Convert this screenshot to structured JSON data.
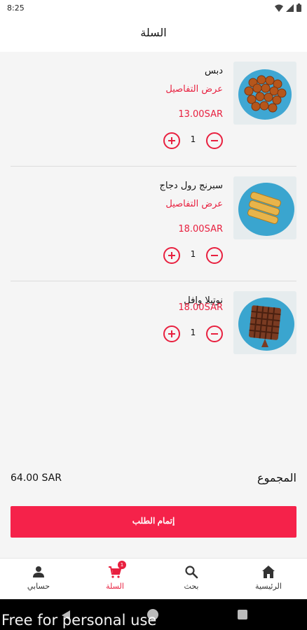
{
  "status_bar": {
    "time": "8:25"
  },
  "header": {
    "title": "السلة"
  },
  "cart": {
    "items": [
      {
        "name": "دبس",
        "details_link": "عرض التفاصيل",
        "price": "13.00SAR",
        "quantity": "1",
        "image": "dbs-balls-on-blue-plate"
      },
      {
        "name": "سبرنج رول دجاج",
        "details_link": "عرض التفاصيل",
        "price": "18.00SAR",
        "quantity": "1",
        "image": "spring-rolls-on-blue-plate"
      },
      {
        "name": "نوتيلا وافل",
        "details_link": "",
        "price": "18.00SAR",
        "quantity": "1",
        "image": "nutella-waffle-on-blue-plate"
      }
    ]
  },
  "summary": {
    "total_label": "المجموع",
    "total_value": "64.00 SAR"
  },
  "checkout": {
    "label": "إتمام الطلب"
  },
  "bottom_nav": {
    "items": [
      {
        "label": "حسابي",
        "icon": "person-icon"
      },
      {
        "label": "السلة",
        "icon": "cart-icon",
        "badge": "1",
        "active": true
      },
      {
        "label": "بحث",
        "icon": "search-icon"
      },
      {
        "label": "الرئيسية",
        "icon": "home-icon"
      }
    ]
  },
  "watermark": "Free for personal use",
  "colors": {
    "accent": "#e8203f",
    "button": "#f5224a",
    "background": "#f5f5f5"
  }
}
